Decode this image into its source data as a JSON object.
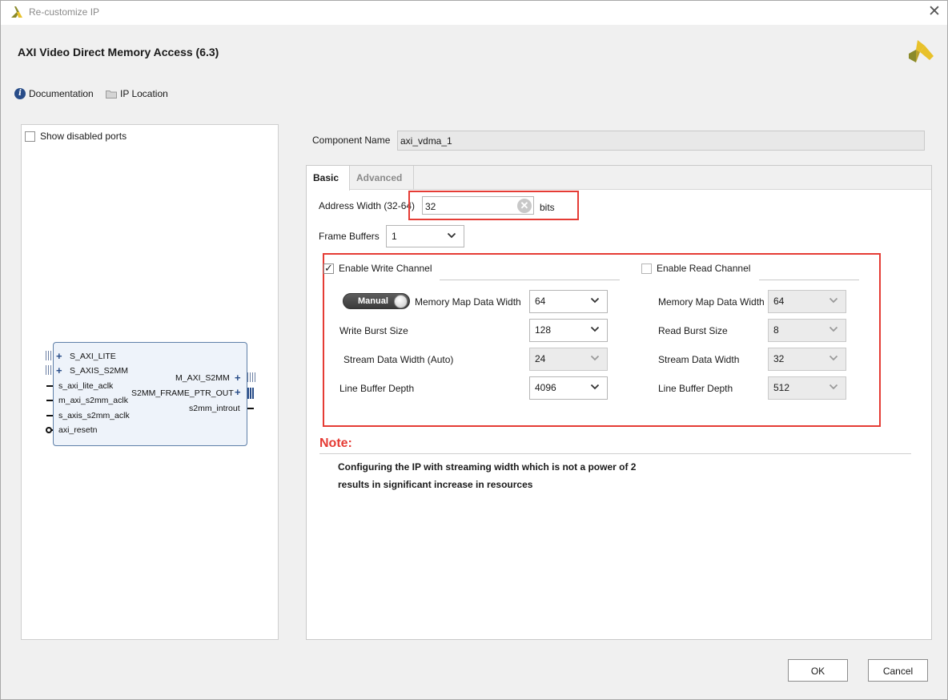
{
  "window": {
    "title": "Re-customize IP",
    "close_glyph": "✕"
  },
  "header": {
    "ip_title": "AXI Video Direct Memory Access (6.3)",
    "documentation_label": "Documentation",
    "ip_location_label": "IP Location",
    "info_icon_glyph": "i"
  },
  "left_panel": {
    "show_disabled_ports_label": "Show disabled ports",
    "show_disabled_ports_checked": false,
    "block": {
      "left_ports": [
        "S_AXI_LITE",
        "S_AXIS_S2MM",
        "s_axi_lite_aclk",
        "m_axi_s2mm_aclk",
        "s_axis_s2mm_aclk",
        "axi_resetn"
      ],
      "right_ports": [
        "M_AXI_S2MM",
        "S2MM_FRAME_PTR_OUT",
        "s2mm_introut"
      ],
      "plus_glyph": "+"
    }
  },
  "component": {
    "label": "Component Name",
    "value": "axi_vdma_1"
  },
  "tabs": [
    {
      "label": "Basic",
      "active": true
    },
    {
      "label": "Advanced",
      "active": false
    }
  ],
  "basic": {
    "address_width": {
      "label": "Address Width (32-64)",
      "value": "32",
      "unit": "bits",
      "clear_glyph": "✕"
    },
    "frame_buffers": {
      "label": "Frame Buffers",
      "value": "1"
    },
    "write_channel": {
      "enable_label": "Enable Write Channel",
      "enabled": true,
      "mode_toggle_label": "Manual",
      "memory_map_data_width": {
        "label": "Memory Map Data Width",
        "value": "64"
      },
      "burst_size": {
        "label": "Write Burst Size",
        "value": "128"
      },
      "stream_data_width": {
        "label": "Stream Data Width (Auto)",
        "value": "24",
        "disabled": true
      },
      "line_buffer_depth": {
        "label": "Line Buffer Depth",
        "value": "4096"
      }
    },
    "read_channel": {
      "enable_label": "Enable Read Channel",
      "enabled": false,
      "memory_map_data_width": {
        "label": "Memory Map Data Width",
        "value": "64"
      },
      "burst_size": {
        "label": "Read Burst Size",
        "value": "8"
      },
      "stream_data_width": {
        "label": "Stream Data Width",
        "value": "32"
      },
      "line_buffer_depth": {
        "label": "Line Buffer Depth",
        "value": "512"
      }
    }
  },
  "note": {
    "title": "Note:",
    "line1": "Configuring the IP with streaming width which is not a power of 2",
    "line2": "results in significant increase in resources"
  },
  "buttons": {
    "ok": "OK",
    "cancel": "Cancel"
  },
  "colors": {
    "highlight_red": "#e53c35",
    "brand_yellow": "#e8c12a",
    "brand_olive": "#8a8a2a",
    "info_blue": "#284c88"
  }
}
